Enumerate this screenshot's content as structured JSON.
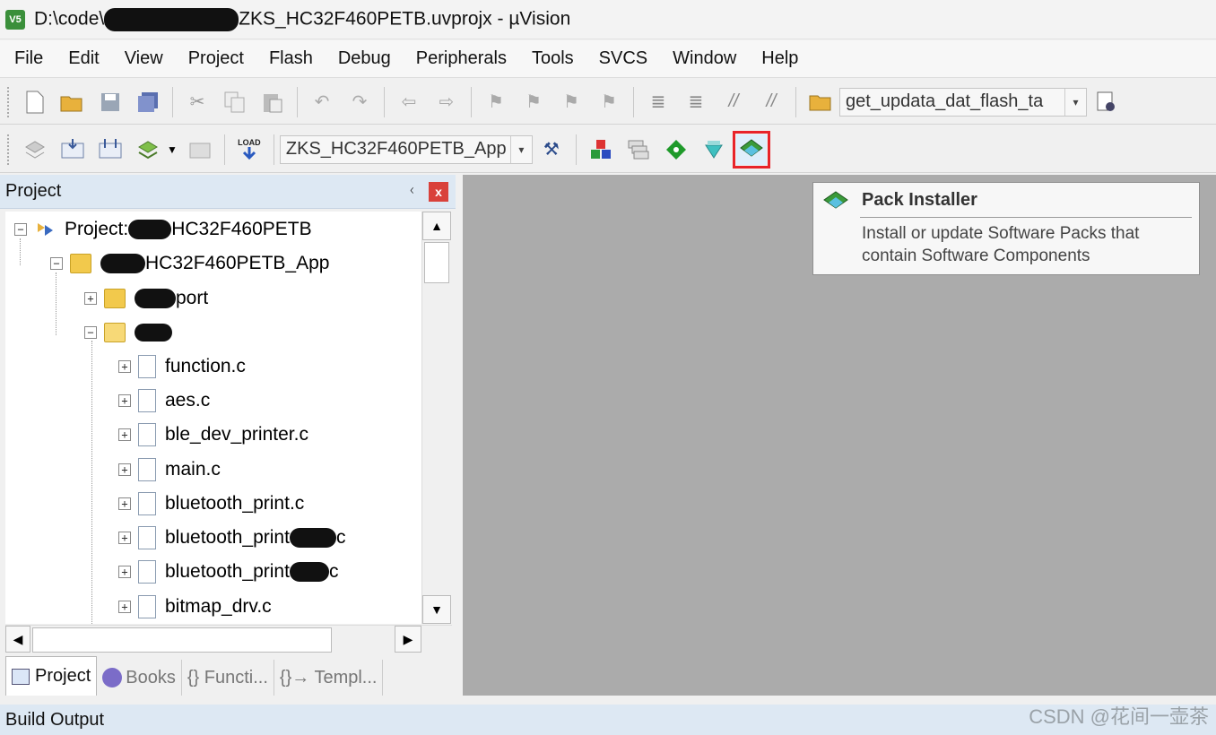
{
  "window": {
    "title_prefix": "D:\\code\\",
    "title_suffix": "ZKS_HC32F460PETB.uvprojx - µVision",
    "app_icon_label": "V5"
  },
  "menu": [
    "File",
    "Edit",
    "View",
    "Project",
    "Flash",
    "Debug",
    "Peripherals",
    "Tools",
    "SVCS",
    "Window",
    "Help"
  ],
  "toolbar1": {
    "function_combo": "get_updata_dat_flash_ta",
    "icons": [
      "new-file-icon",
      "open-folder-icon",
      "save-icon",
      "save-all-icon",
      "cut-icon",
      "copy-icon",
      "paste-icon",
      "undo-icon",
      "redo-icon",
      "navigate-back-icon",
      "navigate-forward-icon",
      "bookmark-icon",
      "bookmark-prev-icon",
      "bookmark-next-icon",
      "bookmark-clear-icon",
      "indent-icon",
      "unindent-icon",
      "comment-icon",
      "uncomment-icon",
      "find-in-files-icon",
      "debug-session-icon"
    ]
  },
  "toolbar2": {
    "load_label": "LOAD",
    "target_combo": "ZKS_HC32F460PETB_App",
    "icons": [
      "translate-icon",
      "build-icon",
      "rebuild-icon",
      "batch-build-icon",
      "stop-build-icon",
      "download-icon",
      "target-options-icon",
      "manage-components-icon",
      "select-packs-icon",
      "event-recorder-icon",
      "manage-run-time-env-icon",
      "pack-installer-icon"
    ]
  },
  "project_panel": {
    "title": "Project",
    "pin_glyph": "ᚲ",
    "close_glyph": "x"
  },
  "tree": {
    "project_label": "Project: ",
    "project_suffix": "HC32F460PETB",
    "target_suffix": "HC32F460PETB_App",
    "group1_suffix": "port",
    "files": [
      "function.c",
      "aes.c",
      "ble_dev_printer.c",
      "main.c",
      "bluetooth_print.c",
      "bluetooth_print",
      "bluetooth_print",
      "bitmap_drv.c"
    ],
    "file_tails": [
      "",
      "",
      "",
      "",
      "",
      "c",
      "c",
      ""
    ]
  },
  "tabs": [
    "Project",
    "Books",
    "{} Functi...",
    "{}→ Templ..."
  ],
  "tooltip": {
    "title": "Pack Installer",
    "body": "Install or update Software Packs that contain Software Components"
  },
  "build_output": {
    "title": "Build Output"
  },
  "watermark": "CSDN @花间一壶茶",
  "colors": {
    "highlight_border": "#e8232a",
    "panel_header": "#dde8f3",
    "workarea": "#ababab"
  }
}
